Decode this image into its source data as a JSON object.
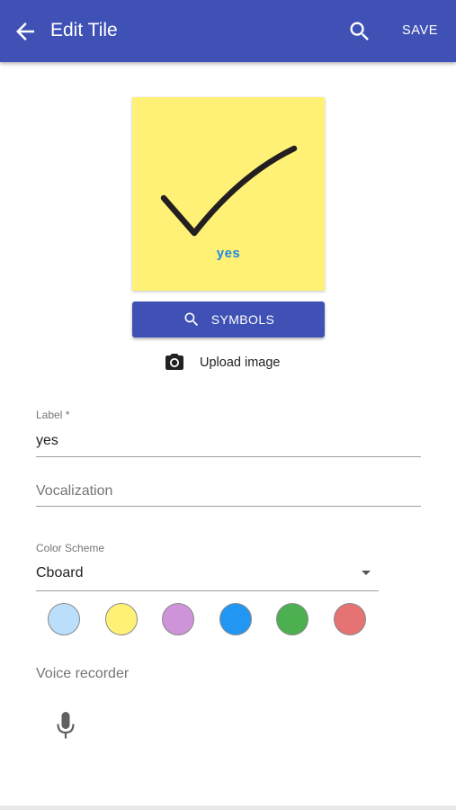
{
  "appbar": {
    "title": "Edit Tile",
    "save_label": "SAVE",
    "background": "#3f51b5"
  },
  "tile": {
    "label": "yes",
    "background": "#fff176",
    "label_color": "#1e88e5",
    "symbol": "checkmark"
  },
  "symbols_button": {
    "label": "SYMBOLS",
    "icon": "search-icon"
  },
  "upload": {
    "label": "Upload image",
    "icon": "camera-icon"
  },
  "form": {
    "label_field": {
      "label": "Label *",
      "value": "yes"
    },
    "vocalization_field": {
      "placeholder": "Vocalization"
    },
    "color_scheme": {
      "label": "Color Scheme",
      "value": "Cboard"
    },
    "colors": [
      "#bbdefb",
      "#fff176",
      "#ce93d8",
      "#2196f3",
      "#4caf50",
      "#e57373"
    ],
    "voice_recorder": {
      "label": "Voice recorder",
      "icon": "microphone-icon"
    }
  }
}
